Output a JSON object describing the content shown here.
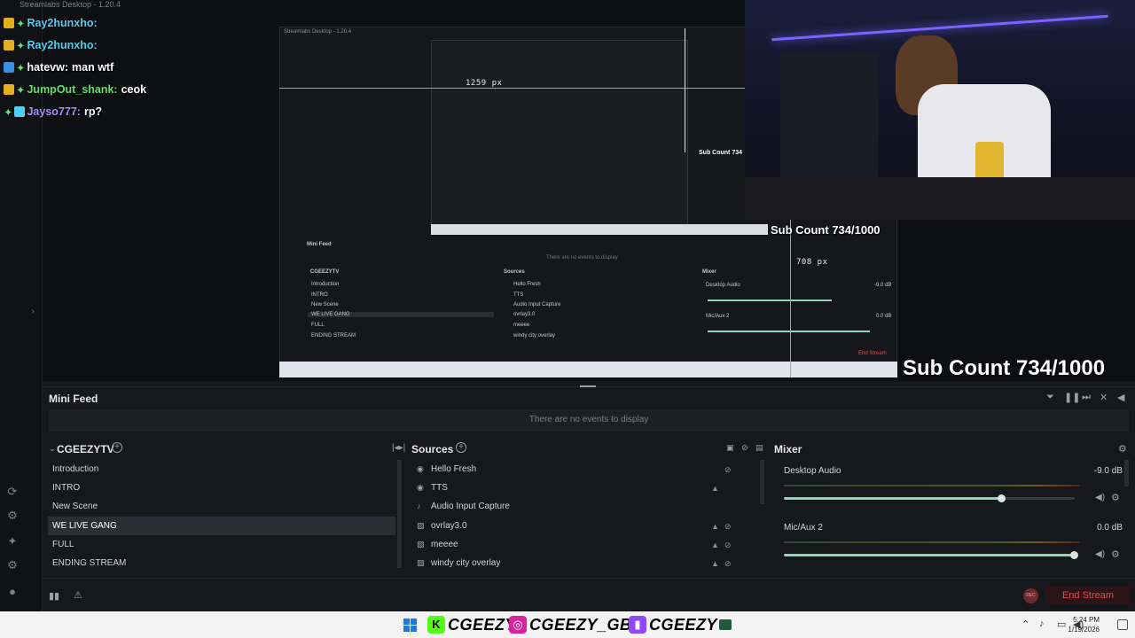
{
  "chat": [
    {
      "name": "Ray2hunxho:",
      "message": "",
      "name_color": "#4fd0f0",
      "badge_color": "#e0b020"
    },
    {
      "name": "Ray2hunxho:",
      "message": "",
      "name_color": "#4fd0f0",
      "badge_color": "#e0b020"
    },
    {
      "name": "hatevw:",
      "message": "man wtf",
      "name_color": "#ffffff",
      "badge_color": "#3a8fe0"
    },
    {
      "name": "JumpOut_shank:",
      "message": "ceok",
      "name_color": "#5fe06d",
      "badge_color": "#e0b020"
    },
    {
      "name": "Jayso777:",
      "message": "rp?",
      "name_color": "#b28bff",
      "badge_color": "#5fe06d"
    }
  ],
  "window_title_overlay": "Streamlabs Desktop - 1.20.4",
  "nested": {
    "title": "Streamlabs Desktop - 1.20.4",
    "px_top": "1259 px",
    "px_right": "708 px",
    "mini_feed": "Mini Feed",
    "no_events": "There are no events to display",
    "scenes_title": "CGEEZYTV",
    "sources_title": "Sources",
    "mixer_title": "Mixer",
    "scenes": [
      "Introduction",
      "INTRO",
      "New Scene",
      "WE LIVE GANG",
      "FULL",
      "ENDING STREAM"
    ],
    "sources": [
      "Hello Fresh",
      "TTS",
      "Audio Input Capture",
      "ovrlay3.0",
      "meeee",
      "windy city overlay"
    ],
    "desktop_audio": "Desktop Audio",
    "desktop_db": "-9.0 dB",
    "mic": "Mic/Aux 2",
    "mic_db": "0.0 dB",
    "end_stream": "End Stream",
    "sub_count_inner": "Sub Count 734"
  },
  "overlay": {
    "sub_count_small": "Sub Count 734/1000",
    "sub_count_big": "Sub Count 734/1000"
  },
  "mini_feed": {
    "title": "Mini Feed",
    "empty": "There are no events to display"
  },
  "scenes": {
    "title": "CGEEZYTV",
    "items": [
      "Introduction",
      "INTRO",
      "New Scene",
      "WE LIVE GANG",
      "FULL",
      "ENDING STREAM"
    ],
    "active_index": 3
  },
  "sources": {
    "title": "Sources",
    "items": [
      {
        "label": "Hello Fresh",
        "icon": "globe-icon"
      },
      {
        "label": "TTS",
        "icon": "globe-icon"
      },
      {
        "label": "Audio Input Capture",
        "icon": "microphone-icon"
      },
      {
        "label": "ovrlay3.0",
        "icon": "image-icon"
      },
      {
        "label": "meeee",
        "icon": "image-icon"
      },
      {
        "label": "windy city overlay",
        "icon": "image-icon"
      }
    ]
  },
  "mixer": {
    "title": "Mixer",
    "channels": [
      {
        "name": "Desktop Audio",
        "db": "-9.0 dB",
        "level": 0.75
      },
      {
        "name": "Mic/Aux 2",
        "db": "0.0 dB",
        "level": 1.0
      }
    ]
  },
  "bottom": {
    "end_stream": "End Stream",
    "rec": "REC"
  },
  "taskbar": {
    "socials": [
      {
        "text": "CGEEZY",
        "icon": "kick-icon",
        "color": "#53fc18",
        "glyph": "K"
      },
      {
        "text": "CGEEZY_GBC",
        "icon": "instagram-icon",
        "color": "#d6249f",
        "glyph": "◎"
      },
      {
        "text": "CGEEZY",
        "icon": "twitch-icon",
        "color": "#9146ff",
        "glyph": "▮"
      }
    ],
    "time": "5:24 PM",
    "date": "1/19/2026"
  },
  "colors": {
    "accent_green": "#35e09a",
    "end_stream_red": "#f0454f"
  }
}
